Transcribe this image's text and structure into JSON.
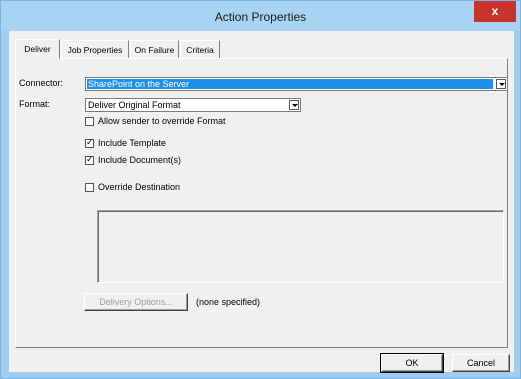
{
  "window": {
    "title": "Action Properties",
    "close_label": "x"
  },
  "tabs": [
    {
      "label": "Deliver",
      "active": true
    },
    {
      "label": "Job Properties",
      "active": false
    },
    {
      "label": "On Failure",
      "active": false
    },
    {
      "label": "Criteria",
      "active": false
    }
  ],
  "deliver": {
    "connector_label": "Connector:",
    "connector_value": "SharePoint on the Server",
    "format_label": "Format:",
    "format_value": "Deliver Original Format",
    "allow_override_label": "Allow sender to override Format",
    "allow_override_checked": false,
    "include_template_label": "Include Template",
    "include_template_checked": true,
    "include_documents_label": "Include Document(s)",
    "include_documents_checked": true,
    "override_destination_label": "Override Destination",
    "override_destination_checked": false,
    "delivery_options_label": "Delivery Options...",
    "delivery_options_status": "(none specified)"
  },
  "buttons": {
    "ok_label": "OK",
    "cancel_label": "Cancel"
  },
  "colors": {
    "title_bar": "#a8d4f3",
    "close_button": "#c7332b",
    "selection": "#1e8fe6",
    "dialog_background": "#f0f0f0"
  }
}
